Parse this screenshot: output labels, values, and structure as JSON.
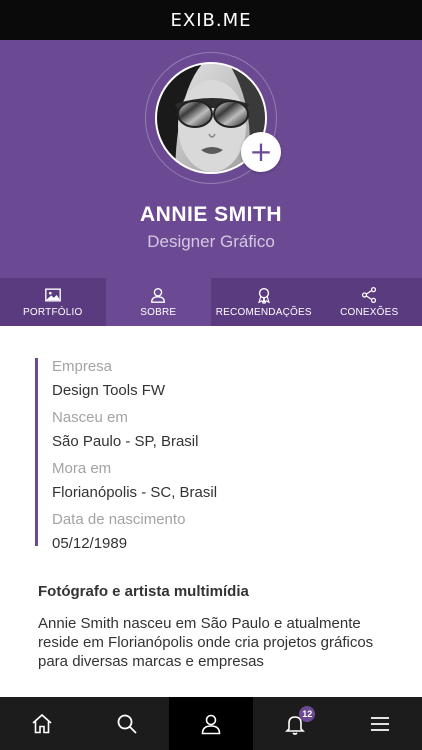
{
  "app": {
    "brand": "EXIB.ME"
  },
  "profile": {
    "name": "ANNIE SMITH",
    "role": "Designer Gráfico"
  },
  "tabs": [
    {
      "label": "PORTFÓLIO",
      "icon": "image-icon",
      "active": false
    },
    {
      "label": "SOBRE",
      "icon": "user-icon",
      "active": true
    },
    {
      "label": "RECOMENDAÇÕES",
      "icon": "award-icon",
      "active": false
    },
    {
      "label": "CONEXÕES",
      "icon": "share-icon",
      "active": false
    }
  ],
  "details": [
    {
      "label": "Empresa",
      "value": "Design Tools FW"
    },
    {
      "label": "Nasceu em",
      "value": "São Paulo - SP, Brasil"
    },
    {
      "label": "Mora em",
      "value": "Florianópolis - SC, Brasil"
    },
    {
      "label": "Data de nascimento",
      "value": "05/12/1989"
    }
  ],
  "bio": {
    "title": "Fotógrafo e artista multimídia",
    "text": "Annie Smith nasceu em São Paulo e atualmente reside em Florianópolis onde cria projetos gráficos para diversas marcas e empresas"
  },
  "bottom_nav": {
    "items": [
      "home-icon",
      "search-icon",
      "profile-icon",
      "bell-icon",
      "menu-icon"
    ],
    "active": "profile-icon",
    "notification_count": "12"
  },
  "colors": {
    "accent": "#6b4a93",
    "tab_bar": "#5a3b80",
    "header": "#0a0a0a",
    "nav": "#1c1c1c"
  }
}
